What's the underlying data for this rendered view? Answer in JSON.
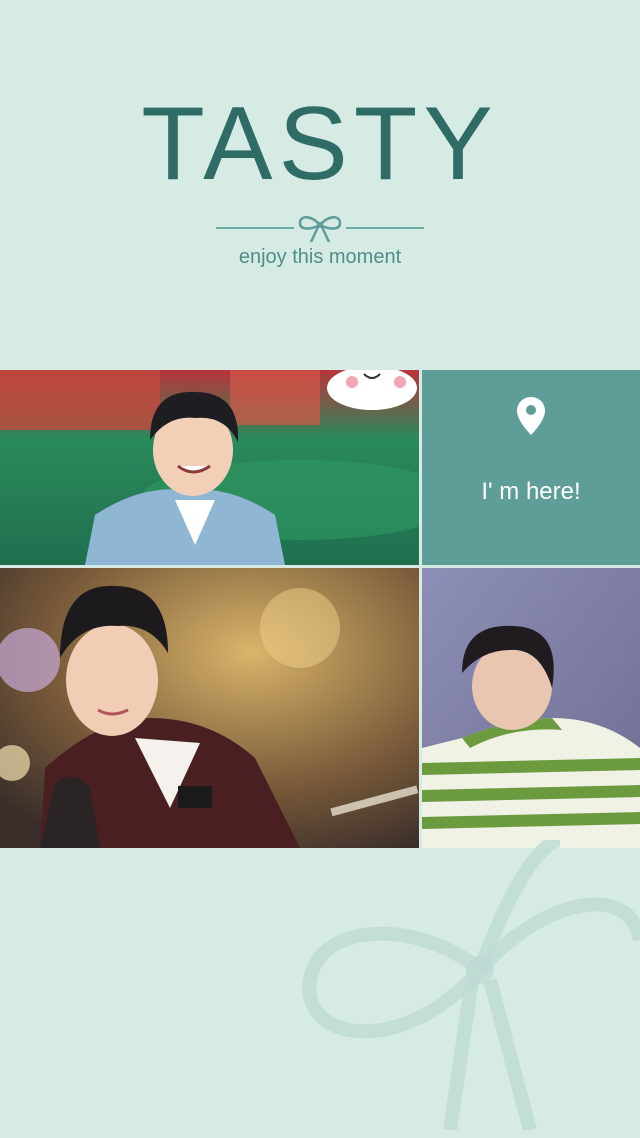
{
  "header": {
    "title": "TASTY",
    "subtitle": "enjoy this moment"
  },
  "location_card": {
    "text": "I' m here!",
    "icon": "map-pin-icon"
  },
  "colors": {
    "background": "#d6ebe4",
    "accent": "#2f6c66",
    "card": "#5e9d98"
  }
}
